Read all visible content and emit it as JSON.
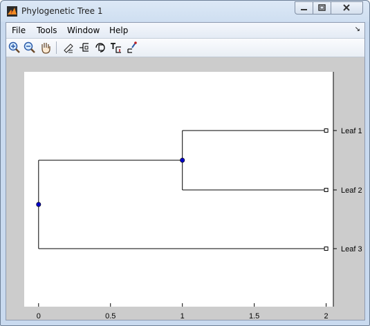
{
  "window": {
    "title": "Phylogenetic Tree 1"
  },
  "menu": {
    "items": [
      "File",
      "Tools",
      "Window",
      "Help"
    ]
  },
  "toolbar": {
    "tools": [
      "zoom-in-icon",
      "zoom-out-icon",
      "pan-hand-icon",
      "prune-icon",
      "collapse-expand-icon",
      "rotate-branch-icon",
      "rename-icon",
      "inspect-icon"
    ]
  },
  "chart_data": {
    "type": "dendrogram",
    "xticks": [
      "0",
      "0.5",
      "1",
      "1.5",
      "2"
    ],
    "xlim": [
      -0.1,
      2.05
    ],
    "leaves": [
      {
        "label": "Leaf 1",
        "x": 2
      },
      {
        "label": "Leaf 2",
        "x": 2
      },
      {
        "label": "Leaf 3",
        "x": 2
      }
    ],
    "branch_nodes": [
      {
        "x": 1,
        "children": [
          "Leaf 1",
          "Leaf 2"
        ]
      },
      {
        "x": 0,
        "children": [
          "Branch 1",
          "Leaf 3"
        ]
      }
    ],
    "grid": false,
    "colors": {
      "node": "#0000c8",
      "line": "#000000"
    }
  }
}
